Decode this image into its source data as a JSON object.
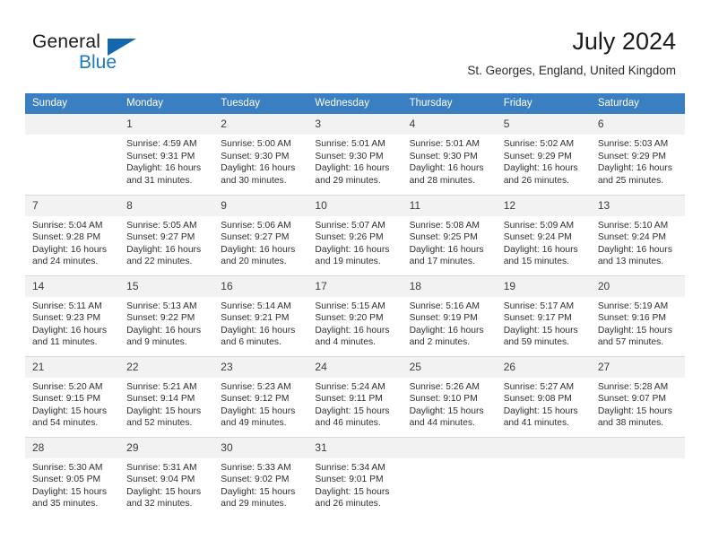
{
  "brand": {
    "name_line1": "General",
    "name_line2": "Blue",
    "color_dark": "#1a1a1a",
    "color_blue": "#1c7ac0",
    "triangle_icon": "triangle-icon"
  },
  "header": {
    "title": "July 2024",
    "location": "St. Georges, England, United Kingdom",
    "accent_color": "#3a7fc1",
    "daynum_bg": "#f2f2f2"
  },
  "weekdays": [
    "Sunday",
    "Monday",
    "Tuesday",
    "Wednesday",
    "Thursday",
    "Friday",
    "Saturday"
  ],
  "labels": {
    "sunrise": "Sunrise:",
    "sunset": "Sunset:",
    "daylight": "Daylight:"
  },
  "weeks": [
    [
      {
        "day": "",
        "blank": true,
        "sunrise": "",
        "sunset": "",
        "daylight_line1": "",
        "daylight_line2": ""
      },
      {
        "day": "1",
        "sunrise": "Sunrise: 4:59 AM",
        "sunset": "Sunset: 9:31 PM",
        "daylight_line1": "Daylight: 16 hours",
        "daylight_line2": "and 31 minutes."
      },
      {
        "day": "2",
        "sunrise": "Sunrise: 5:00 AM",
        "sunset": "Sunset: 9:30 PM",
        "daylight_line1": "Daylight: 16 hours",
        "daylight_line2": "and 30 minutes."
      },
      {
        "day": "3",
        "sunrise": "Sunrise: 5:01 AM",
        "sunset": "Sunset: 9:30 PM",
        "daylight_line1": "Daylight: 16 hours",
        "daylight_line2": "and 29 minutes."
      },
      {
        "day": "4",
        "sunrise": "Sunrise: 5:01 AM",
        "sunset": "Sunset: 9:30 PM",
        "daylight_line1": "Daylight: 16 hours",
        "daylight_line2": "and 28 minutes."
      },
      {
        "day": "5",
        "sunrise": "Sunrise: 5:02 AM",
        "sunset": "Sunset: 9:29 PM",
        "daylight_line1": "Daylight: 16 hours",
        "daylight_line2": "and 26 minutes."
      },
      {
        "day": "6",
        "sunrise": "Sunrise: 5:03 AM",
        "sunset": "Sunset: 9:29 PM",
        "daylight_line1": "Daylight: 16 hours",
        "daylight_line2": "and 25 minutes."
      }
    ],
    [
      {
        "day": "7",
        "sunrise": "Sunrise: 5:04 AM",
        "sunset": "Sunset: 9:28 PM",
        "daylight_line1": "Daylight: 16 hours",
        "daylight_line2": "and 24 minutes."
      },
      {
        "day": "8",
        "sunrise": "Sunrise: 5:05 AM",
        "sunset": "Sunset: 9:27 PM",
        "daylight_line1": "Daylight: 16 hours",
        "daylight_line2": "and 22 minutes."
      },
      {
        "day": "9",
        "sunrise": "Sunrise: 5:06 AM",
        "sunset": "Sunset: 9:27 PM",
        "daylight_line1": "Daylight: 16 hours",
        "daylight_line2": "and 20 minutes."
      },
      {
        "day": "10",
        "sunrise": "Sunrise: 5:07 AM",
        "sunset": "Sunset: 9:26 PM",
        "daylight_line1": "Daylight: 16 hours",
        "daylight_line2": "and 19 minutes."
      },
      {
        "day": "11",
        "sunrise": "Sunrise: 5:08 AM",
        "sunset": "Sunset: 9:25 PM",
        "daylight_line1": "Daylight: 16 hours",
        "daylight_line2": "and 17 minutes."
      },
      {
        "day": "12",
        "sunrise": "Sunrise: 5:09 AM",
        "sunset": "Sunset: 9:24 PM",
        "daylight_line1": "Daylight: 16 hours",
        "daylight_line2": "and 15 minutes."
      },
      {
        "day": "13",
        "sunrise": "Sunrise: 5:10 AM",
        "sunset": "Sunset: 9:24 PM",
        "daylight_line1": "Daylight: 16 hours",
        "daylight_line2": "and 13 minutes."
      }
    ],
    [
      {
        "day": "14",
        "sunrise": "Sunrise: 5:11 AM",
        "sunset": "Sunset: 9:23 PM",
        "daylight_line1": "Daylight: 16 hours",
        "daylight_line2": "and 11 minutes."
      },
      {
        "day": "15",
        "sunrise": "Sunrise: 5:13 AM",
        "sunset": "Sunset: 9:22 PM",
        "daylight_line1": "Daylight: 16 hours",
        "daylight_line2": "and 9 minutes."
      },
      {
        "day": "16",
        "sunrise": "Sunrise: 5:14 AM",
        "sunset": "Sunset: 9:21 PM",
        "daylight_line1": "Daylight: 16 hours",
        "daylight_line2": "and 6 minutes."
      },
      {
        "day": "17",
        "sunrise": "Sunrise: 5:15 AM",
        "sunset": "Sunset: 9:20 PM",
        "daylight_line1": "Daylight: 16 hours",
        "daylight_line2": "and 4 minutes."
      },
      {
        "day": "18",
        "sunrise": "Sunrise: 5:16 AM",
        "sunset": "Sunset: 9:19 PM",
        "daylight_line1": "Daylight: 16 hours",
        "daylight_line2": "and 2 minutes."
      },
      {
        "day": "19",
        "sunrise": "Sunrise: 5:17 AM",
        "sunset": "Sunset: 9:17 PM",
        "daylight_line1": "Daylight: 15 hours",
        "daylight_line2": "and 59 minutes."
      },
      {
        "day": "20",
        "sunrise": "Sunrise: 5:19 AM",
        "sunset": "Sunset: 9:16 PM",
        "daylight_line1": "Daylight: 15 hours",
        "daylight_line2": "and 57 minutes."
      }
    ],
    [
      {
        "day": "21",
        "sunrise": "Sunrise: 5:20 AM",
        "sunset": "Sunset: 9:15 PM",
        "daylight_line1": "Daylight: 15 hours",
        "daylight_line2": "and 54 minutes."
      },
      {
        "day": "22",
        "sunrise": "Sunrise: 5:21 AM",
        "sunset": "Sunset: 9:14 PM",
        "daylight_line1": "Daylight: 15 hours",
        "daylight_line2": "and 52 minutes."
      },
      {
        "day": "23",
        "sunrise": "Sunrise: 5:23 AM",
        "sunset": "Sunset: 9:12 PM",
        "daylight_line1": "Daylight: 15 hours",
        "daylight_line2": "and 49 minutes."
      },
      {
        "day": "24",
        "sunrise": "Sunrise: 5:24 AM",
        "sunset": "Sunset: 9:11 PM",
        "daylight_line1": "Daylight: 15 hours",
        "daylight_line2": "and 46 minutes."
      },
      {
        "day": "25",
        "sunrise": "Sunrise: 5:26 AM",
        "sunset": "Sunset: 9:10 PM",
        "daylight_line1": "Daylight: 15 hours",
        "daylight_line2": "and 44 minutes."
      },
      {
        "day": "26",
        "sunrise": "Sunrise: 5:27 AM",
        "sunset": "Sunset: 9:08 PM",
        "daylight_line1": "Daylight: 15 hours",
        "daylight_line2": "and 41 minutes."
      },
      {
        "day": "27",
        "sunrise": "Sunrise: 5:28 AM",
        "sunset": "Sunset: 9:07 PM",
        "daylight_line1": "Daylight: 15 hours",
        "daylight_line2": "and 38 minutes."
      }
    ],
    [
      {
        "day": "28",
        "sunrise": "Sunrise: 5:30 AM",
        "sunset": "Sunset: 9:05 PM",
        "daylight_line1": "Daylight: 15 hours",
        "daylight_line2": "and 35 minutes."
      },
      {
        "day": "29",
        "sunrise": "Sunrise: 5:31 AM",
        "sunset": "Sunset: 9:04 PM",
        "daylight_line1": "Daylight: 15 hours",
        "daylight_line2": "and 32 minutes."
      },
      {
        "day": "30",
        "sunrise": "Sunrise: 5:33 AM",
        "sunset": "Sunset: 9:02 PM",
        "daylight_line1": "Daylight: 15 hours",
        "daylight_line2": "and 29 minutes."
      },
      {
        "day": "31",
        "sunrise": "Sunrise: 5:34 AM",
        "sunset": "Sunset: 9:01 PM",
        "daylight_line1": "Daylight: 15 hours",
        "daylight_line2": "and 26 minutes."
      },
      {
        "day": "",
        "blank": true,
        "sunrise": "",
        "sunset": "",
        "daylight_line1": "",
        "daylight_line2": ""
      },
      {
        "day": "",
        "blank": true,
        "sunrise": "",
        "sunset": "",
        "daylight_line1": "",
        "daylight_line2": ""
      },
      {
        "day": "",
        "blank": true,
        "sunrise": "",
        "sunset": "",
        "daylight_line1": "",
        "daylight_line2": ""
      }
    ]
  ]
}
